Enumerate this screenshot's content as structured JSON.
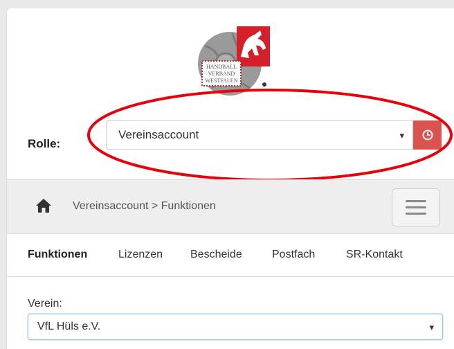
{
  "logo": {
    "lines": [
      "HANDBALL",
      "VERBAND",
      "WESTFALEN"
    ]
  },
  "role": {
    "label": "Rolle:",
    "selected": "Vereinsaccount",
    "caret": "▾",
    "history_icon": "clock-icon"
  },
  "annotation": {
    "color": "#e8000b"
  },
  "navbar": {
    "home_icon": "home-icon",
    "breadcrumb": "Vereinsaccount > Funktionen",
    "menu_icon": "hamburger-icon"
  },
  "tabs": [
    {
      "label": "Funktionen",
      "active": true
    },
    {
      "label": "Lizenzen",
      "active": false
    },
    {
      "label": "Bescheide",
      "active": false
    },
    {
      "label": "Postfach",
      "active": false
    },
    {
      "label": "SR-Kontakt",
      "active": false
    }
  ],
  "verein": {
    "label": "Verein:",
    "selected": "VfL Hüls e.V.",
    "caret": "▾"
  },
  "colors": {
    "accent_red": "#d9534f",
    "navbar_bg": "#eeeeee",
    "focus_border": "#9cc3e6"
  }
}
